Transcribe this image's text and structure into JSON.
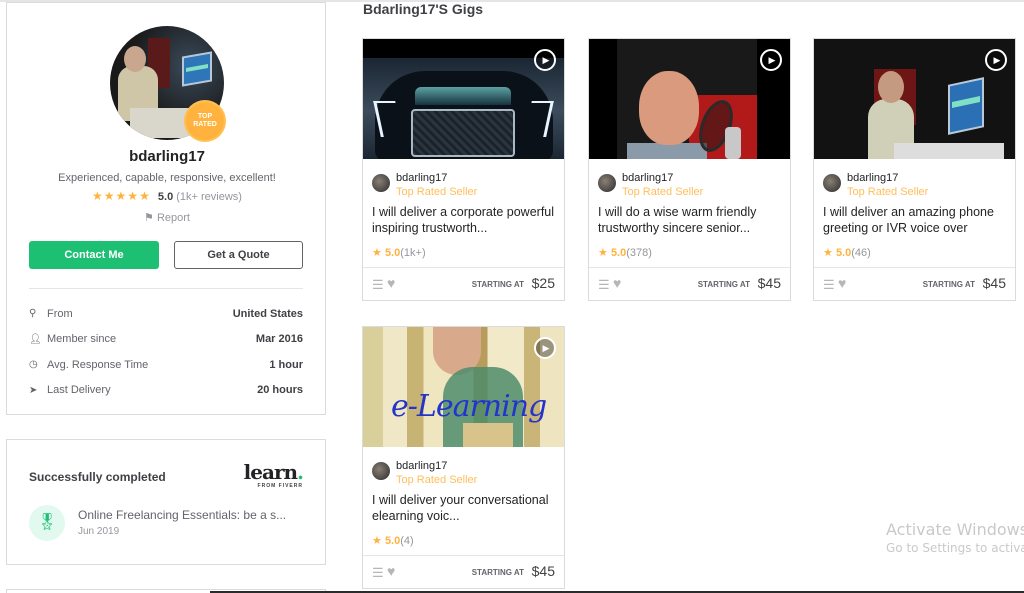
{
  "profile": {
    "username": "bdarling17",
    "badge": "TOP RATED",
    "tagline": "Experienced, capable, responsive, excellent!",
    "stars": "★★★★★",
    "rating": "5.0",
    "reviews": "(1k+ reviews)",
    "report_label": "Report",
    "contact_button": "Contact Me",
    "quote_button": "Get a Quote",
    "stats": [
      {
        "icon": "location-pin-icon",
        "label": "From",
        "value": "United States"
      },
      {
        "icon": "user-icon",
        "label": "Member since",
        "value": "Mar 2016"
      },
      {
        "icon": "clock-icon",
        "label": "Avg. Response Time",
        "value": "1 hour"
      },
      {
        "icon": "paper-plane-icon",
        "label": "Last Delivery",
        "value": "20 hours"
      }
    ]
  },
  "learn": {
    "title": "Successfully completed",
    "logo_word": "learn",
    "logo_dot": ".",
    "logo_sub": "FROM FIVERR",
    "course_name": "Online Freelancing Essentials: be a s...",
    "course_date": "Jun 2019"
  },
  "gigs": {
    "section_title": "Bdarling17'S Gigs",
    "starting_label": "STARTING AT",
    "items": [
      {
        "seller": "bdarling17",
        "level": "Top Rated Seller",
        "title": "I will deliver a corporate powerful inspiring trustworth...",
        "rating": "5.0",
        "count": "(1k+)",
        "price": "$25",
        "thumb_text": ""
      },
      {
        "seller": "bdarling17",
        "level": "Top Rated Seller",
        "title": "I will do a wise warm friendly trustworthy sincere senior...",
        "rating": "5.0",
        "count": "(378)",
        "price": "$45",
        "thumb_text": ""
      },
      {
        "seller": "bdarling17",
        "level": "Top Rated Seller",
        "title": "I will deliver an amazing phone greeting or IVR voice over",
        "rating": "5.0",
        "count": "(46)",
        "price": "$45",
        "thumb_text": ""
      },
      {
        "seller": "bdarling17",
        "level": "Top Rated Seller",
        "title": "I will deliver your conversational elearning voic...",
        "rating": "5.0",
        "count": "(4)",
        "price": "$45",
        "thumb_text": "e-Learning"
      }
    ]
  },
  "watermark": {
    "title": "Activate Windows",
    "subtitle": "Go to Settings to activate Windows."
  }
}
